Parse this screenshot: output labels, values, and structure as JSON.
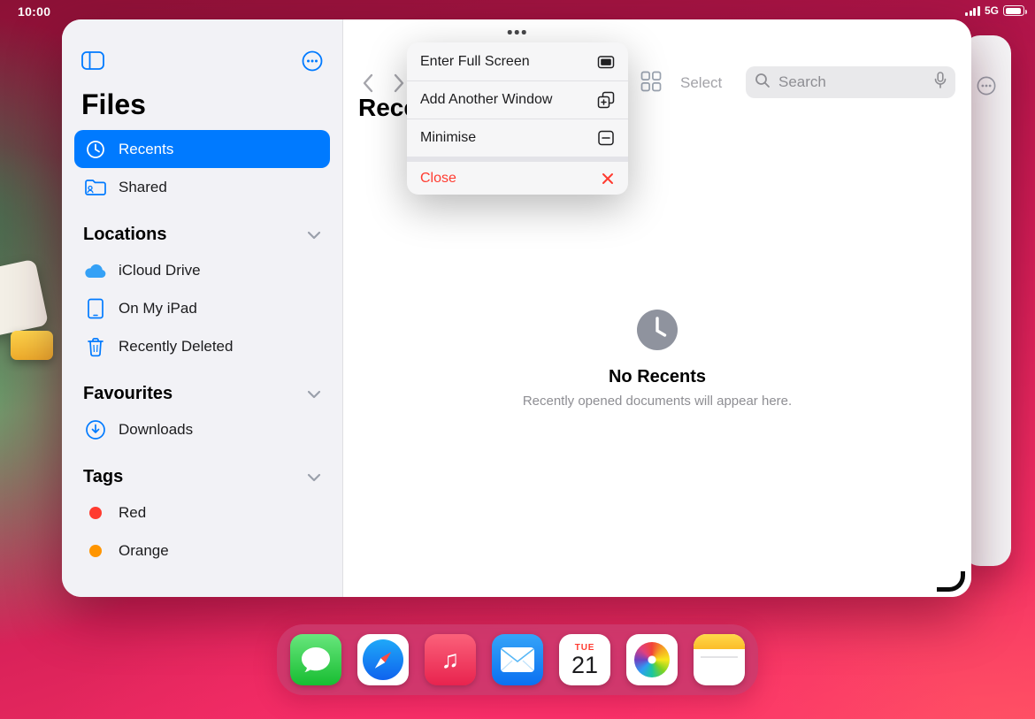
{
  "status_bar": {
    "time": "10:00",
    "network": "5G"
  },
  "window": {
    "sidebar": {
      "title": "Files",
      "items": [
        {
          "label": "Recents",
          "icon": "clock-icon",
          "selected": true
        },
        {
          "label": "Shared",
          "icon": "shared-folder-icon",
          "selected": false
        }
      ],
      "sections": [
        {
          "label": "Locations",
          "items": [
            {
              "label": "iCloud Drive",
              "icon": "cloud-icon"
            },
            {
              "label": "On My iPad",
              "icon": "ipad-icon"
            },
            {
              "label": "Recently Deleted",
              "icon": "trash-icon"
            }
          ]
        },
        {
          "label": "Favourites",
          "items": [
            {
              "label": "Downloads",
              "icon": "download-circle-icon"
            }
          ]
        },
        {
          "label": "Tags",
          "items": [
            {
              "label": "Red",
              "icon": "red-tag-dot",
              "color": "#ff3b30"
            },
            {
              "label": "Orange",
              "icon": "orange-tag-dot",
              "color": "#ff9500"
            }
          ]
        }
      ]
    },
    "toolbar": {
      "title": "Recents",
      "select_label": "Select",
      "search_placeholder": "Search"
    },
    "menu": {
      "items": [
        {
          "label": "Enter Full Screen",
          "icon": "enter-full-screen-icon"
        },
        {
          "label": "Add Another Window",
          "icon": "add-window-icon"
        },
        {
          "label": "Minimise",
          "icon": "minimise-icon"
        },
        {
          "label": "Close",
          "icon": "close-x-icon",
          "destructive": true
        }
      ]
    },
    "empty_state": {
      "title": "No Recents",
      "subtitle": "Recently opened documents will appear here."
    }
  },
  "dock": {
    "apps": [
      "messages",
      "safari",
      "music",
      "mail",
      "calendar",
      "photos",
      "notes"
    ],
    "calendar": {
      "weekday": "TUE",
      "day": "21"
    },
    "music_glyph": "♫"
  },
  "colors": {
    "accent": "#007aff",
    "destructive": "#ff3b30",
    "selected_bg": "#007aff"
  }
}
